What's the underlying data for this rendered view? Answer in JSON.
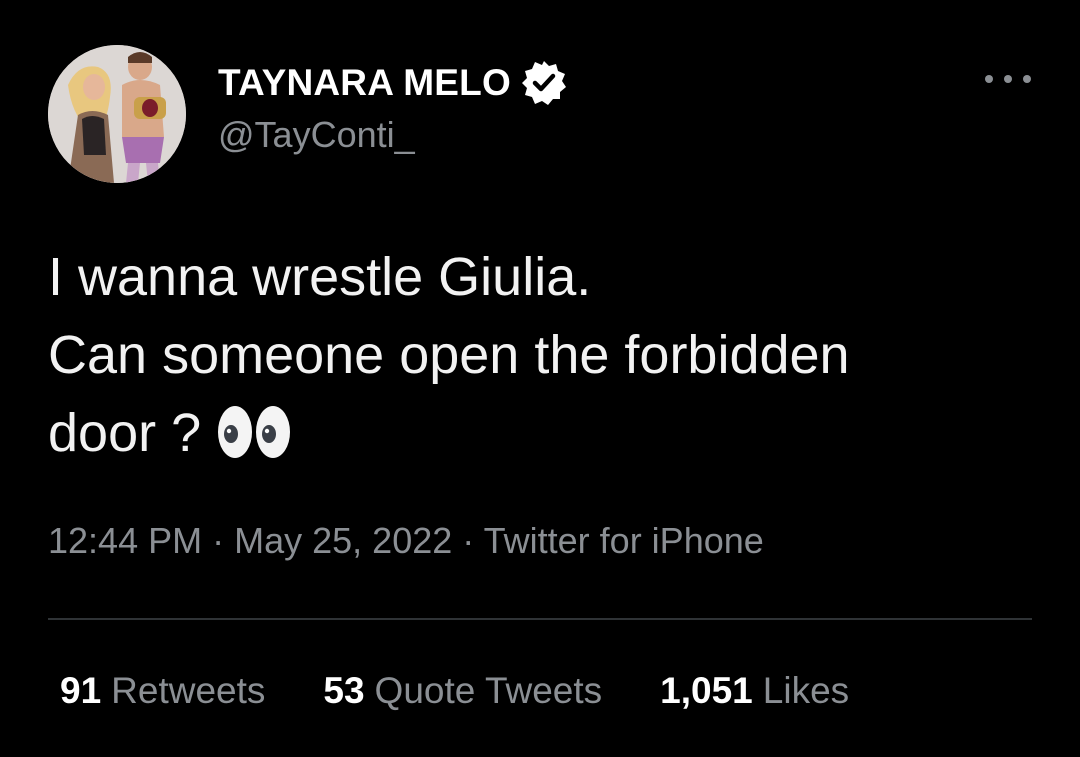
{
  "user": {
    "display_name": "TAYNARA MELO",
    "handle": "@TayConti_",
    "verified": true,
    "verified_icon": "verified-badge-icon",
    "avatar": "profile-photo"
  },
  "menu_icon": "more-options-icon",
  "tweet": {
    "lines": [
      "I wanna wrestle Giulia.",
      "Can someone open the forbidden",
      "door ?"
    ],
    "emoji": "eyes-emoji"
  },
  "meta": {
    "time": "12:44 PM",
    "separator": "·",
    "date": "May 25, 2022",
    "source": "Twitter for iPhone"
  },
  "stats": [
    {
      "count": "91",
      "label": "Retweets"
    },
    {
      "count": "53",
      "label": "Quote Tweets"
    },
    {
      "count": "1,051",
      "label": "Likes"
    }
  ],
  "colors": {
    "background": "#000000",
    "primary_text": "#ffffff",
    "secondary_text": "#8b8f94",
    "divider": "#2f3336"
  }
}
